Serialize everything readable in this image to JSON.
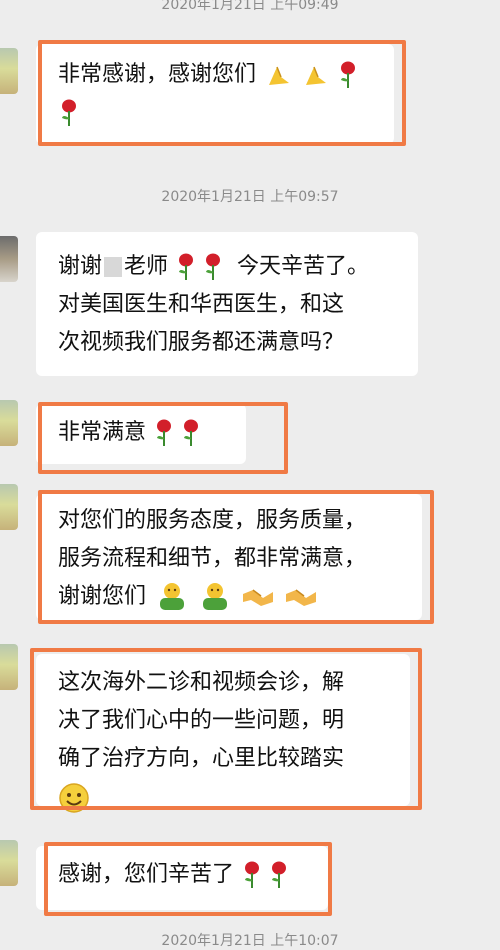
{
  "timestamps": {
    "top": "2020年1月21日 上午09:49",
    "mid": "2020年1月21日 上午09:57",
    "bottom": "2020年1月21日 上午10:07"
  },
  "messages": {
    "m1": {
      "line1": "非常感谢，感谢您们",
      "line2": ""
    },
    "m2": {
      "line1a": "谢谢",
      "line1b": "老师",
      "line1c": "今天辛苦了。",
      "line2": "对美国医生和华西医生，和这",
      "line3": "次视频我们服务都还满意吗？"
    },
    "m3": {
      "line1": "非常满意"
    },
    "m4": {
      "line1": "对您们的服务态度，服务质量，",
      "line2": "服务流程和细节，都非常满意，",
      "line3": "谢谢您们"
    },
    "m5": {
      "line1": "这次海外二诊和视频会诊，解",
      "line2": "决了我们心中的一些问题，明",
      "line3": "确了治疗方向，心里比较踏实"
    },
    "m6": {
      "line1": "感谢，您们辛苦了"
    }
  },
  "emoji_names": [
    "folded-hands",
    "rose",
    "hug",
    "handshake",
    "smile"
  ],
  "colors": {
    "highlight": "#f07a45",
    "bubble": "#ffffff",
    "background": "#ededed",
    "timestamp": "#8a8a8a"
  }
}
